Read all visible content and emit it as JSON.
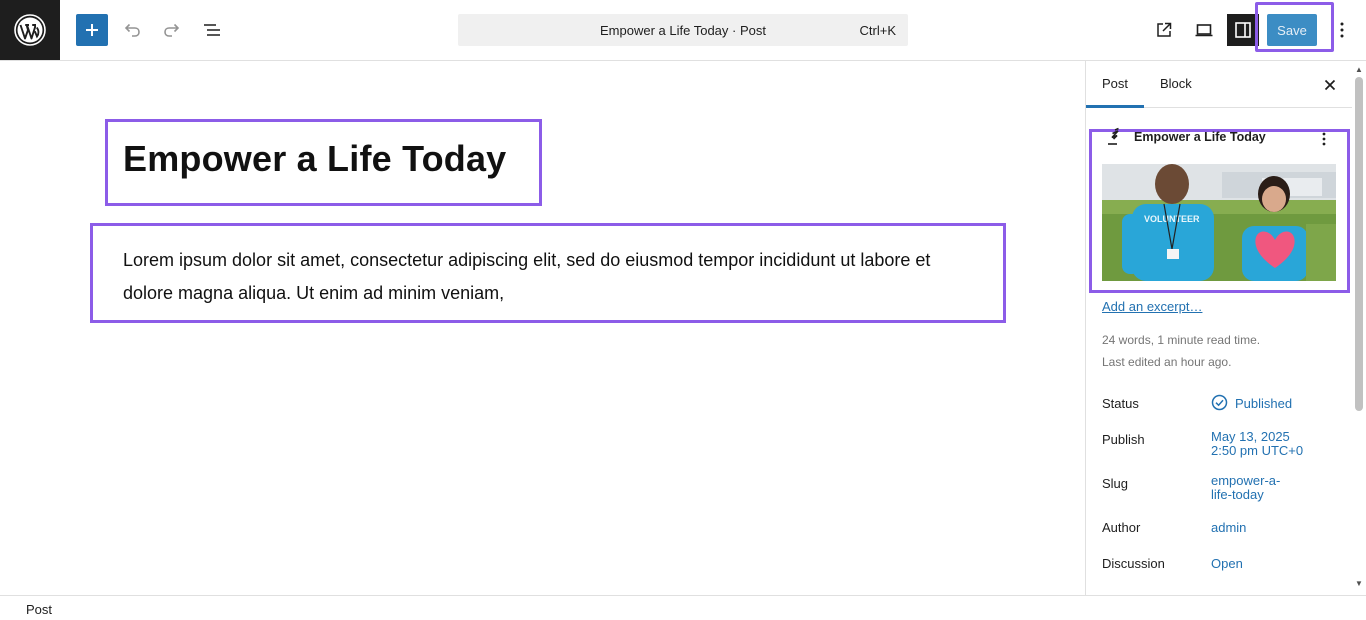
{
  "toolbar": {
    "logo_icon": "wordpress-logo",
    "add_icon": "plus-icon",
    "undo_icon": "undo-icon",
    "redo_icon": "redo-icon",
    "list_view_icon": "list-view-icon",
    "document_title": "Empower a Life Today · Post",
    "shortcut": "Ctrl+K",
    "view_icon": "external-link-icon",
    "preview_icon": "desktop-icon",
    "settings_icon": "sidebar-toggle-icon",
    "save_label": "Save",
    "more_icon": "more-vertical-icon",
    "accent_color": "#2271b1",
    "highlight_color": "#8c5ce8"
  },
  "editor": {
    "title": "Empower a Life Today",
    "paragraph": "Lorem ipsum dolor sit amet, consectetur adipiscing elit, sed do eiusmod tempor incididunt ut labore et dolore magna aliqua. Ut enim ad minim veniam,"
  },
  "sidebar": {
    "tabs": [
      {
        "label": "Post",
        "active": true
      },
      {
        "label": "Block",
        "active": false
      }
    ],
    "close_icon": "close-icon",
    "card": {
      "icon": "post-edit-icon",
      "title": "Empower a Life Today",
      "menu_icon": "more-vertical-icon",
      "image_alt": "volunteers-photo",
      "image_text": "VOLUNTEER"
    },
    "excerpt_link": "Add an excerpt…",
    "meta": {
      "words": "24 words, 1 minute read time.",
      "edited": "Last edited an hour ago."
    },
    "rows": [
      {
        "label": "Status",
        "value": "Published"
      },
      {
        "label": "Publish",
        "value_line1": "May 13, 2025",
        "value_line2": "2:50 pm UTC+0"
      },
      {
        "label": "Slug",
        "value_line1": "empower-a-",
        "value_line2": "life-today"
      },
      {
        "label": "Author",
        "value": "admin"
      },
      {
        "label": "Discussion",
        "value": "Open"
      }
    ]
  },
  "footer": {
    "breadcrumb": "Post"
  }
}
